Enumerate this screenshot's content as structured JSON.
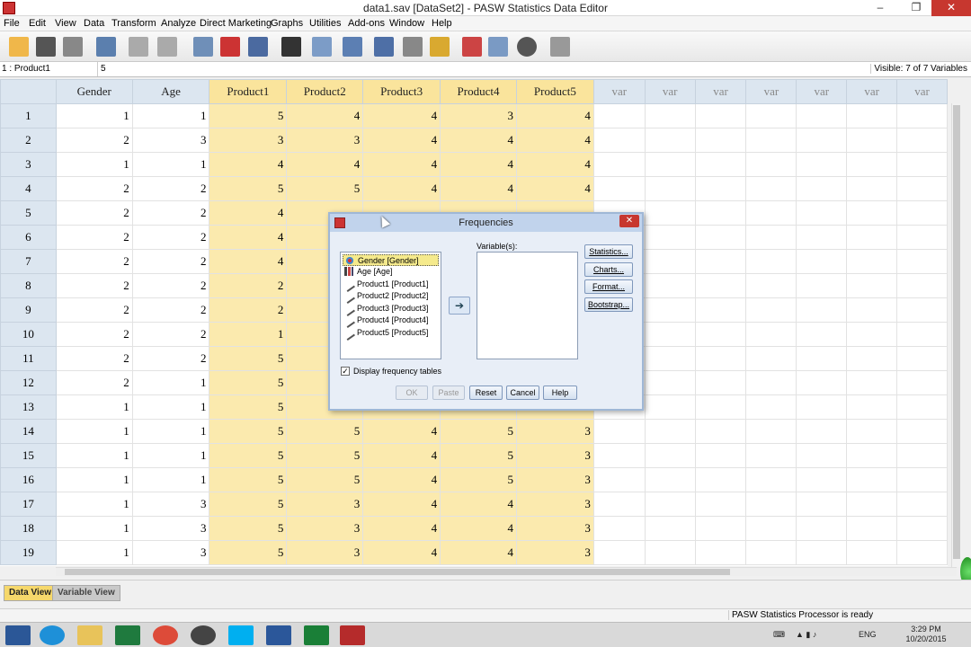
{
  "window": {
    "title": "data1.sav [DataSet2] - PASW Statistics Data Editor",
    "controls": [
      "–",
      "❐",
      "✕"
    ]
  },
  "menu": [
    "File",
    "Edit",
    "View",
    "Data",
    "Transform",
    "Analyze",
    "Direct Marketing",
    "Graphs",
    "Utilities",
    "Add-ons",
    "Window",
    "Help"
  ],
  "cellbar": {
    "ref": "1 : Product1",
    "value": "5",
    "visible": "Visible: 7 of 7 Variables"
  },
  "grid": {
    "columns": [
      "Gender",
      "Age",
      "Product1",
      "Product2",
      "Product3",
      "Product4",
      "Product5",
      "var",
      "var",
      "var",
      "var",
      "var",
      "var",
      "var"
    ],
    "rows": [
      {
        "n": "1",
        "c": [
          "1",
          "1",
          "5",
          "4",
          "4",
          "3",
          "4"
        ]
      },
      {
        "n": "2",
        "c": [
          "2",
          "3",
          "3",
          "3",
          "4",
          "4",
          "4"
        ]
      },
      {
        "n": "3",
        "c": [
          "1",
          "1",
          "4",
          "4",
          "4",
          "4",
          "4"
        ]
      },
      {
        "n": "4",
        "c": [
          "2",
          "2",
          "5",
          "5",
          "4",
          "4",
          "4"
        ]
      },
      {
        "n": "5",
        "c": [
          "2",
          "2",
          "4",
          "",
          "",
          "",
          ""
        ]
      },
      {
        "n": "6",
        "c": [
          "2",
          "2",
          "4",
          "",
          "",
          "",
          ""
        ]
      },
      {
        "n": "7",
        "c": [
          "2",
          "2",
          "4",
          "",
          "",
          "",
          ""
        ]
      },
      {
        "n": "8",
        "c": [
          "2",
          "2",
          "2",
          "",
          "",
          "",
          ""
        ]
      },
      {
        "n": "9",
        "c": [
          "2",
          "2",
          "2",
          "",
          "",
          "",
          ""
        ]
      },
      {
        "n": "10",
        "c": [
          "2",
          "2",
          "1",
          "",
          "",
          "",
          ""
        ]
      },
      {
        "n": "11",
        "c": [
          "2",
          "2",
          "5",
          "",
          "",
          "",
          ""
        ]
      },
      {
        "n": "12",
        "c": [
          "2",
          "1",
          "5",
          "",
          "",
          "",
          ""
        ]
      },
      {
        "n": "13",
        "c": [
          "1",
          "1",
          "5",
          "",
          "",
          "",
          ""
        ]
      },
      {
        "n": "14",
        "c": [
          "1",
          "1",
          "5",
          "5",
          "4",
          "5",
          "3"
        ]
      },
      {
        "n": "15",
        "c": [
          "1",
          "1",
          "5",
          "5",
          "4",
          "5",
          "3"
        ]
      },
      {
        "n": "16",
        "c": [
          "1",
          "1",
          "5",
          "5",
          "4",
          "5",
          "3"
        ]
      },
      {
        "n": "17",
        "c": [
          "1",
          "3",
          "5",
          "3",
          "4",
          "4",
          "3"
        ]
      },
      {
        "n": "18",
        "c": [
          "1",
          "3",
          "5",
          "3",
          "4",
          "4",
          "3"
        ]
      },
      {
        "n": "19",
        "c": [
          "1",
          "3",
          "5",
          "3",
          "4",
          "4",
          "3"
        ]
      }
    ]
  },
  "tabs": {
    "data_view": "Data View",
    "variable_view": "Variable View"
  },
  "status": "PASW Statistics Processor is ready",
  "dialog": {
    "title": "Frequencies",
    "source_items": [
      "Gender [Gender]",
      "Age [Age]",
      "Product1 [Product1]",
      "Product2 [Product2]",
      "Product3 [Product3]",
      "Product4 [Product4]",
      "Product5 [Product5]"
    ],
    "variables_label": "Variable(s):",
    "side_buttons": [
      "Statistics...",
      "Charts...",
      "Format...",
      "Bootstrap..."
    ],
    "checkbox_label": "Display frequency tables",
    "checkbox_checked": true,
    "buttons": {
      "ok": "OK",
      "paste": "Paste",
      "reset": "Reset",
      "cancel": "Cancel",
      "help": "Help"
    }
  },
  "taskbar": {
    "lang": "ENG",
    "time": "3:29 PM",
    "date": "10/20/2015"
  }
}
